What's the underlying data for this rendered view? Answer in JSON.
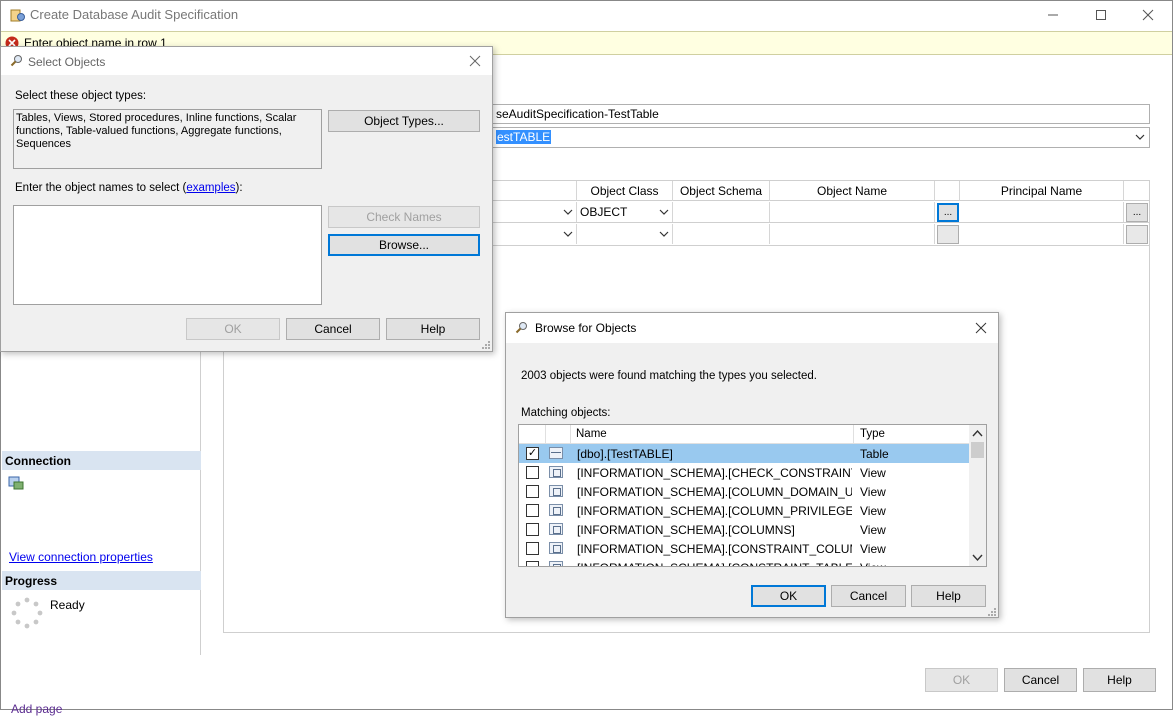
{
  "main_window": {
    "title": "Create Database Audit Specification",
    "error_text": "Enter object name in row 1",
    "name_value": "seAuditSpecification-TestTable",
    "audit_value": "estTABLE",
    "grid": {
      "headers": [
        "Object Class",
        "Object Schema",
        "Object Name",
        "Principal Name"
      ],
      "row1_object_class": "OBJECT",
      "dots": "..."
    },
    "connection_header": "Connection",
    "view_connection_link": "View connection properties",
    "progress_header": "Progress",
    "progress_status": "Ready",
    "buttons": {
      "ok": "OK",
      "cancel": "Cancel",
      "help": "Help"
    },
    "bottom_cut_text": "Add page"
  },
  "select_objects": {
    "title": "Select Objects",
    "types_label": "Select these object types:",
    "types_value": "Tables, Views, Stored procedures, Inline functions, Scalar functions, Table-valued functions, Aggregate functions, Sequences",
    "object_types_button": "Object Types...",
    "names_label_prefix": "Enter the object names to select (",
    "names_label_link": "examples",
    "names_label_suffix": "):",
    "check_names_button": "Check Names",
    "browse_button": "Browse...",
    "ok_button": "OK",
    "cancel_button": "Cancel",
    "help_button": "Help"
  },
  "browse_objects": {
    "title": "Browse for Objects",
    "found_text": "2003 objects were found matching the types you selected.",
    "matching_label": "Matching objects:",
    "columns": {
      "name": "Name",
      "type": "Type"
    },
    "rows": [
      {
        "name": "[dbo].[TestTABLE]",
        "type": "Table",
        "checked": true,
        "selected": true
      },
      {
        "name": "[INFORMATION_SCHEMA].[CHECK_CONSTRAINTS]",
        "type": "View",
        "checked": false
      },
      {
        "name": "[INFORMATION_SCHEMA].[COLUMN_DOMAIN_US...",
        "type": "View",
        "checked": false
      },
      {
        "name": "[INFORMATION_SCHEMA].[COLUMN_PRIVILEGES]",
        "type": "View",
        "checked": false
      },
      {
        "name": "[INFORMATION_SCHEMA].[COLUMNS]",
        "type": "View",
        "checked": false
      },
      {
        "name": "[INFORMATION_SCHEMA].[CONSTRAINT_COLUM...",
        "type": "View",
        "checked": false
      },
      {
        "name": "[INFORMATION_SCHEMA].[CONSTRAINT_TABLE...",
        "type": "View",
        "checked": false
      }
    ],
    "ok_button": "OK",
    "cancel_button": "Cancel",
    "help_button": "Help"
  },
  "colors": {
    "error_bar": "#ffffe1",
    "selection_blue": "#99c9ef",
    "section_header": "#d9e4f1",
    "accent": "#0078d7"
  }
}
